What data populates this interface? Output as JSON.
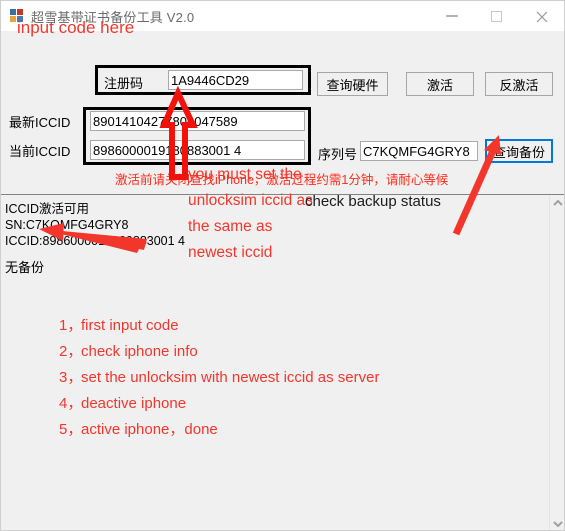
{
  "window": {
    "title": "超雪基带证书备份工具 V2.0",
    "icon": "app-icon",
    "minimize_label": "—",
    "maximize_label": "□",
    "close_label": "✕"
  },
  "form": {
    "regcode_label": "注册码",
    "regcode_value": "1A9446CD29",
    "newest_iccid_label": "最新ICCID",
    "newest_iccid_value": "89014104277806047589",
    "current_iccid_label": "当前ICCID",
    "current_iccid_value": "8986000019180883001 4",
    "serial_label": "序列号",
    "serial_value": "C7KQMFG4GRY8"
  },
  "buttons": {
    "query_hardware": "查询硬件",
    "activate": "激活",
    "deactivate": "反激活",
    "query_backup": "查询备份"
  },
  "notice": {
    "warning": "激活前请关闭查找iPhone，激活过程约需1分钟，请耐心等候"
  },
  "log": {
    "lines": "ICCID激活可用\nSN:C7KQMFG4GRY8\nICCID:8986000019180883001 4",
    "backup_status": "无备份"
  },
  "scrollbar": {
    "up_arrow": "scroll-up-icon",
    "down_arrow": "scroll-down-icon"
  },
  "annotations": {
    "input_code": "input code here",
    "must_set_line1": "you must set the",
    "must_set_line2": "unlocksim iccid as",
    "must_set_line3": "the same as",
    "must_set_line4": "newest iccid",
    "check_backup": "check backup status",
    "steps": [
      {
        "num": "1，",
        "text": "first input code"
      },
      {
        "num": "2，",
        "text": "check iphone info"
      },
      {
        "num": "3，",
        "text": "set the unlocksim with newest iccid as server"
      },
      {
        "num": "4，",
        "text": "deactive iphone"
      },
      {
        "num": "5，",
        "text": "active iphone，done"
      }
    ]
  },
  "colors": {
    "annotation_red": "#f2362c",
    "focus_blue": "#0078d7",
    "window_bg": "#f0f0f0"
  }
}
